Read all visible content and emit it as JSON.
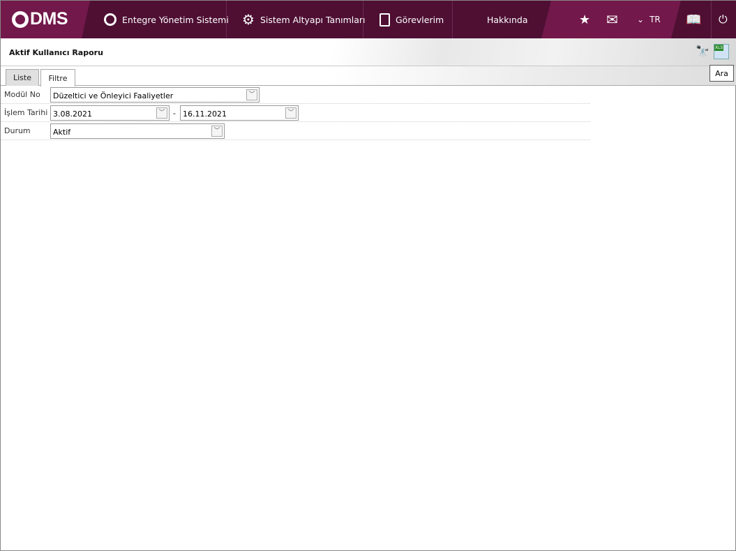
{
  "nav": {
    "logo": "DMS",
    "items": [
      {
        "label": "Entegre Yönetim Sistemi"
      },
      {
        "label": "Sistem Altyapı Tanımları"
      },
      {
        "label": "Görevlerim"
      },
      {
        "label": "Hakkında"
      }
    ],
    "language": "TR"
  },
  "page": {
    "title": "Aktif Kullanıcı Raporu",
    "tooltip": "Ara"
  },
  "tabs": [
    {
      "label": "Liste"
    },
    {
      "label": "Filtre"
    }
  ],
  "filters": {
    "modul": {
      "label": "Modül No",
      "value": "Düzeltici ve Önleyici Faaliyetler"
    },
    "tarih": {
      "label": "İşlem Tarihi",
      "from": "3.08.2021",
      "sep": "-",
      "to": "16.11.2021"
    },
    "durum": {
      "label": "Durum",
      "value": "Aktif"
    }
  }
}
